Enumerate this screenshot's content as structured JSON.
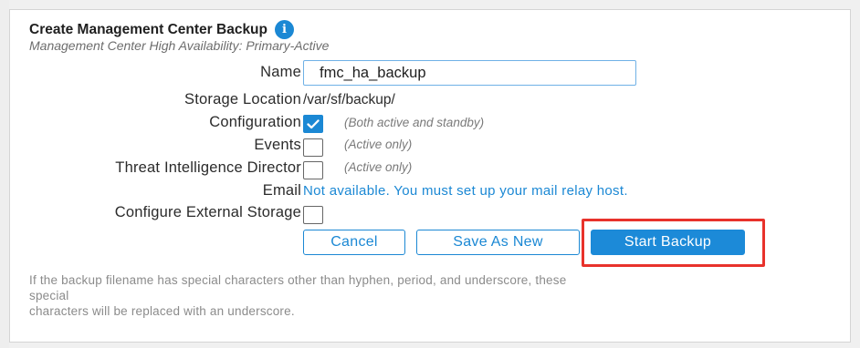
{
  "header": {
    "title": "Create Management Center Backup",
    "info_glyph": "i",
    "subtitle": "Management Center High Availability: Primary-Active"
  },
  "form": {
    "name": {
      "label": "Name",
      "value": "fmc_ha_backup"
    },
    "storage_location": {
      "label": "Storage Location",
      "value": "/var/sf/backup/"
    },
    "configuration": {
      "label": "Configuration",
      "checked": true,
      "hint": "(Both active and standby)"
    },
    "events": {
      "label": "Events",
      "checked": false,
      "hint": "(Active only)"
    },
    "tid": {
      "label": "Threat Intelligence Director",
      "checked": false,
      "hint": "(Active only)"
    },
    "email": {
      "label": "Email",
      "message": "Not available. You must set up your mail relay host."
    },
    "external_storage": {
      "label": "Configure External Storage",
      "checked": false
    }
  },
  "buttons": {
    "cancel": "Cancel",
    "save_as_new": "Save As New",
    "start_backup": "Start Backup"
  },
  "footnote": {
    "line1": "If the backup filename has special characters other than hyphen, period, and underscore, these",
    "line2": "special",
    "line3": "characters will be replaced with an underscore."
  },
  "colors": {
    "accent": "#1b88d4",
    "highlight": "#e8322b",
    "hint_text": "#7a7a7a"
  },
  "icons": {
    "info": "info-icon",
    "check": "checkmark-icon"
  }
}
